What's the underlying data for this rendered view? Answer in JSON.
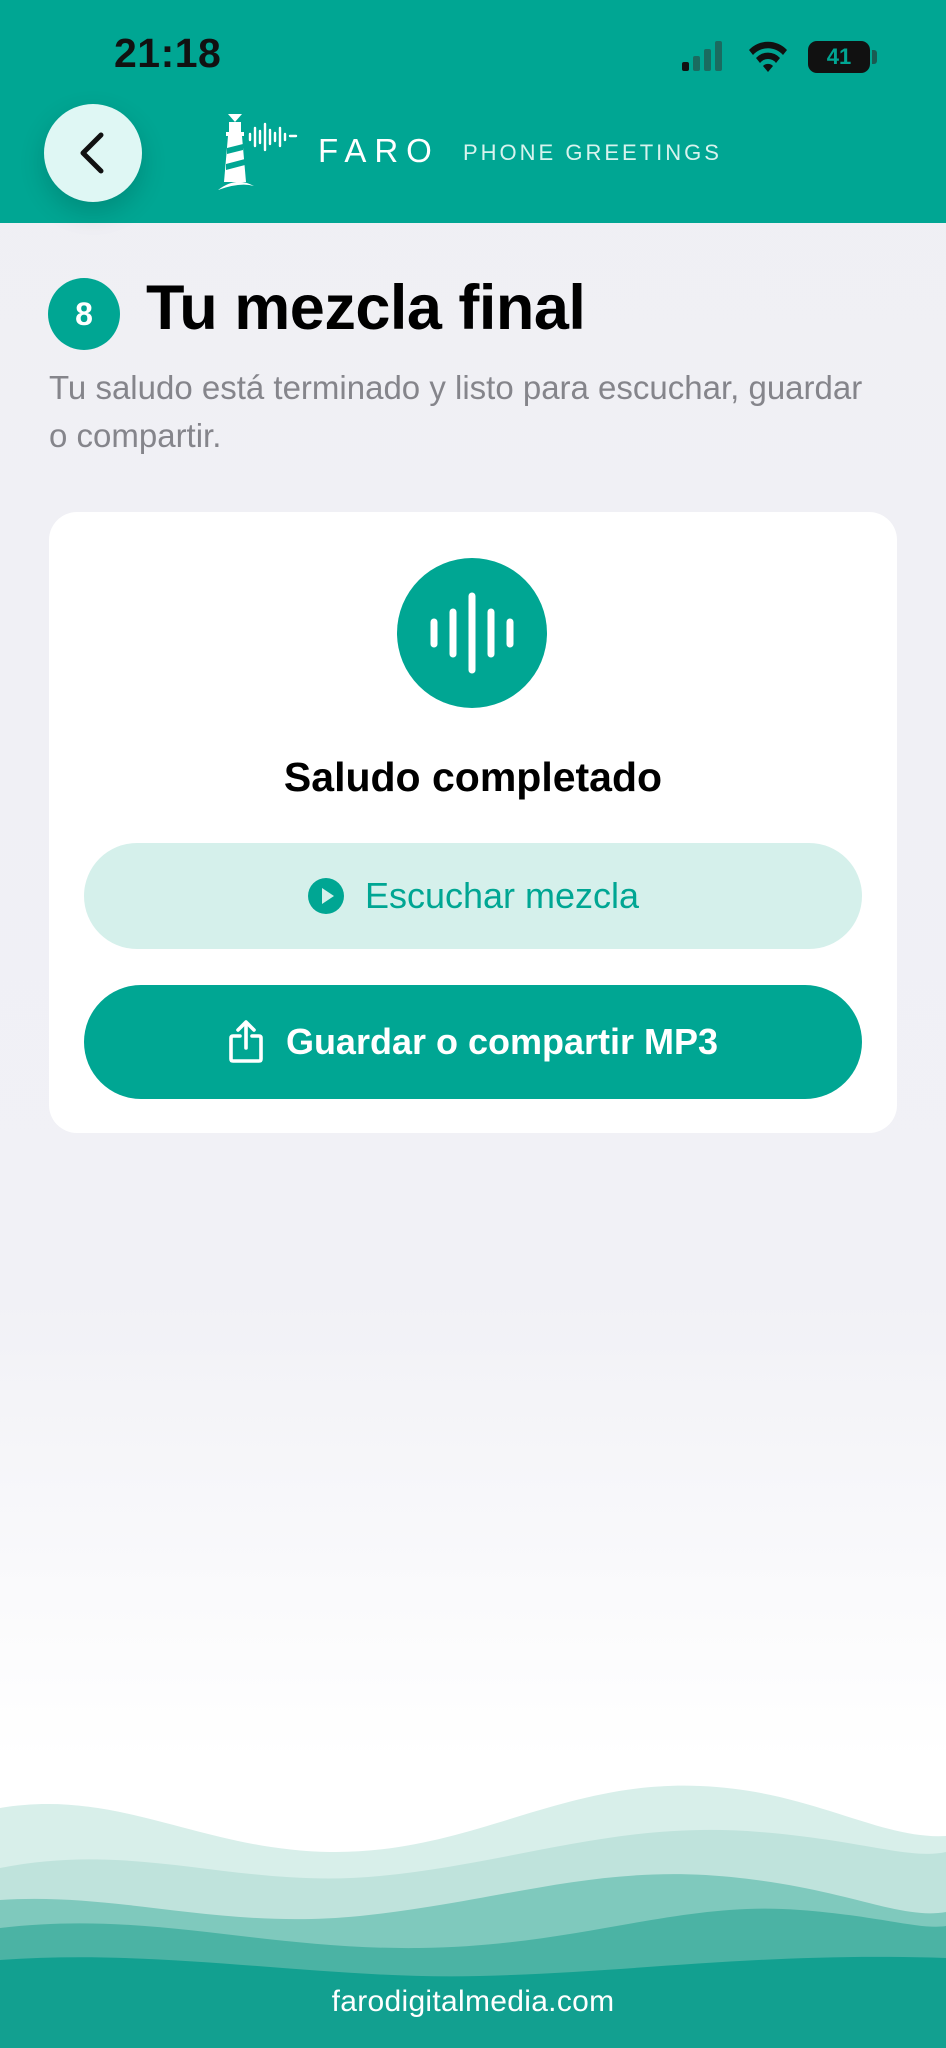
{
  "status_bar": {
    "time": "21:18",
    "battery": "41",
    "icons": [
      "cellular-signal-icon",
      "wifi-icon",
      "battery-icon"
    ]
  },
  "header": {
    "back_icon": "chevron-left-icon",
    "logo_icon": "lighthouse-soundwave-icon",
    "brand_name": "FARO",
    "brand_tagline": "PHONE GREETINGS"
  },
  "step": {
    "number": "8",
    "title": "Tu mezcla final",
    "subtitle": "Tu saludo está terminado y listo para escuchar, guardar o compartir."
  },
  "card": {
    "icon": "waveform-icon",
    "title": "Saludo completado",
    "listen_button": {
      "icon": "play-circle-icon",
      "label": "Escuchar mezcla"
    },
    "share_button": {
      "icon": "share-icon",
      "label": "Guardar o compartir MP3"
    }
  },
  "footer": {
    "link": "farodigitalmedia.com"
  },
  "colors": {
    "brand_teal": "#00a693",
    "light_teal": "#d5f0eb",
    "page_background": "#efeff4",
    "subtitle_gray": "#85858b"
  }
}
